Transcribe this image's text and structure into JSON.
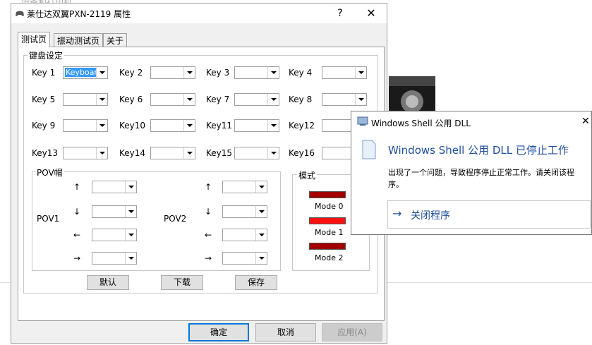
{
  "background": {
    "title": "设备和打印机"
  },
  "dialog": {
    "title": "莱仕达双翼PXN-2119 属性",
    "help": "?",
    "close": "✕",
    "tabs": [
      "测试页",
      "振动测试页",
      "关于"
    ],
    "keyboard_group": "键盘设定",
    "keys": [
      {
        "label": "Key  1",
        "value": "Keyboard"
      },
      {
        "label": "Key  2",
        "value": ""
      },
      {
        "label": "Key  3",
        "value": ""
      },
      {
        "label": "Key  4",
        "value": ""
      },
      {
        "label": "Key  5",
        "value": ""
      },
      {
        "label": "Key  6",
        "value": ""
      },
      {
        "label": "Key  7",
        "value": ""
      },
      {
        "label": "Key  8",
        "value": ""
      },
      {
        "label": "Key  9",
        "value": ""
      },
      {
        "label": "Key10",
        "value": ""
      },
      {
        "label": "Key11",
        "value": ""
      },
      {
        "label": "Key12",
        "value": ""
      },
      {
        "label": "Key13",
        "value": ""
      },
      {
        "label": "Key14",
        "value": ""
      },
      {
        "label": "Key15",
        "value": ""
      },
      {
        "label": "Key16",
        "value": ""
      }
    ],
    "pov_group": "POV帽",
    "pov1_label": "POV1",
    "pov2_label": "POV2",
    "pov_arrows": [
      "↑",
      "↓",
      "←",
      "→"
    ],
    "mode_group": "模式",
    "modes": [
      {
        "label": "Mode 0",
        "color": "#a00000"
      },
      {
        "label": "Mode 1",
        "color": "#ff1010"
      },
      {
        "label": "Mode 2",
        "color": "#a00000"
      }
    ],
    "buttons": {
      "default": "默认",
      "download": "下载",
      "save": "保存"
    },
    "footer": {
      "ok": "确定",
      "cancel": "取消",
      "apply": "应用(A)"
    }
  },
  "error_dialog": {
    "title": "Windows Shell 公用 DLL",
    "close": "✕",
    "heading": "Windows Shell 公用 DLL 已停止工作",
    "message": "出现了一个问题，导致程序停止正常工作。请关闭该程序。",
    "action": "关闭程序",
    "action_icon": "→"
  }
}
